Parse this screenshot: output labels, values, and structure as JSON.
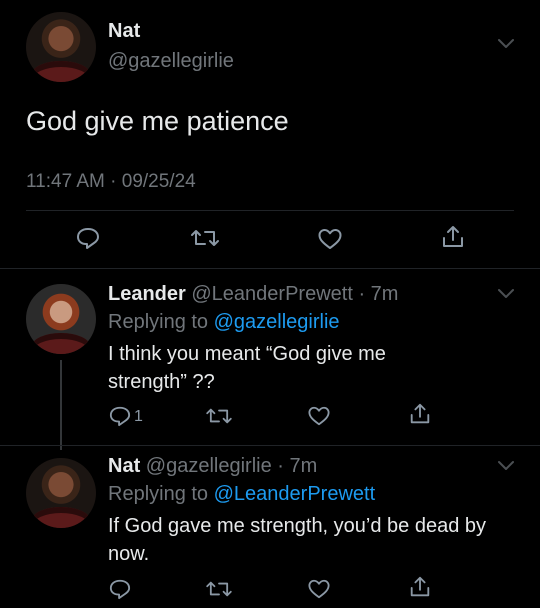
{
  "main_tweet": {
    "name": "Nat",
    "handle": "@gazellegirlie",
    "text": "God give me patience",
    "timestamp": "11:47 AM · 09/25/24"
  },
  "replies": [
    {
      "name": "Leander",
      "handle": "@LeanderPrewett",
      "time": "· 7m",
      "replying_prefix": "Replying to",
      "replying_to": "@gazellegirlie",
      "text_line1": "I think you meant “God give me",
      "text_line2": "strength” ??",
      "reply_count": "1"
    },
    {
      "name": "Nat",
      "handle": "@gazellegirlie",
      "time": "· 7m",
      "replying_prefix": "Replying to",
      "replying_to": "@LeanderPrewett",
      "text_line1": "If God gave me strength, you’d be dead by",
      "text_line2": "now."
    }
  ],
  "icons": {
    "reply": "reply-icon",
    "retweet": "retweet-icon",
    "like": "like-icon",
    "share": "share-icon",
    "more": "chevron-down-icon"
  },
  "colors": {
    "background": "#000000",
    "text": "#e7e9ea",
    "muted": "#71767b",
    "link": "#1d9bf0"
  }
}
